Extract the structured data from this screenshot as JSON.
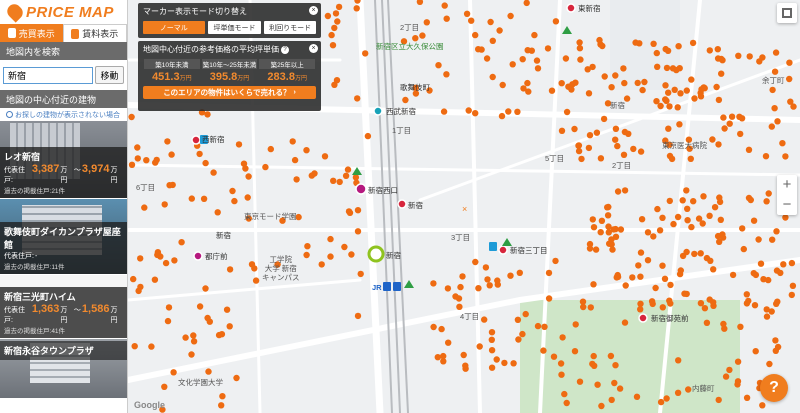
{
  "brand": {
    "name": "PRICE MAP",
    "color": "#f07d1e"
  },
  "tabs": [
    {
      "label": "売買表示",
      "icon": "sale-icon",
      "active": false
    },
    {
      "label": "賃料表示",
      "icon": "rent-icon",
      "active": true
    }
  ],
  "search": {
    "heading": "地図内を検索",
    "value": "新宿",
    "button": "移動"
  },
  "buildings_section": {
    "heading": "地図の中心付近の建物",
    "hint": "お探しの建物が表示されない場合"
  },
  "properties": [
    {
      "name": "レオ新宿",
      "price_label": "代表住戸:",
      "price_low": "3,387",
      "price_high": "3,974",
      "unit": "万円",
      "sep": "～",
      "count_label": "過去の掲載住戸:",
      "count": "21件"
    },
    {
      "name": "歌舞伎町ダイカンプラザ屋座館",
      "price_label": "代表住戸:",
      "price_low": "-",
      "price_high": "",
      "unit": "",
      "sep": "",
      "count_label": "過去の掲載住戸:",
      "count": "11件"
    },
    {
      "name": "新宿三光町ハイム",
      "price_label": "代表住戸:",
      "price_low": "1,363",
      "price_high": "1,586",
      "unit": "万円",
      "sep": "～",
      "count_label": "過去の掲載住戸:",
      "count": "41件"
    },
    {
      "name": "新宿永谷タウンプラザ",
      "price_label": "",
      "price_low": "",
      "price_high": "",
      "unit": "",
      "sep": "",
      "count_label": "",
      "count": ""
    }
  ],
  "mode_panel": {
    "title": "マーカー表示モード切り替え",
    "buttons": [
      "ノーマル",
      "坪単価モード",
      "利回りモード"
    ],
    "active": 0
  },
  "price_panel": {
    "title": "地図中心付近の参考価格の平均坪単価",
    "columns": [
      {
        "label": "築10年未満",
        "value": "451.3",
        "unit": "万円"
      },
      {
        "label": "築10年～25年未満",
        "value": "395.8",
        "unit": "万円"
      },
      {
        "label": "築25年以上",
        "value": "283.8",
        "unit": "万円"
      }
    ],
    "cta": "このエリアの物件はいくらで売れる？"
  },
  "map_labels": {
    "shinjuku_park": "新宿区立大久保公園",
    "kabukicho": "歌舞伎町",
    "nishi_shinjuku_ekimae": "西武新宿",
    "chome1": "1丁目",
    "chome2": "2丁目",
    "chome3": "3丁目",
    "chome4": "4丁目",
    "chome5": "5丁目",
    "chome6": "6丁目",
    "shinjuku_nishiguchi": "新宿西口",
    "shinjuku_station": "新宿",
    "shinjuku_station2": "新宿",
    "nishi_shinjuku": "西新宿",
    "tocho": "都庁前",
    "tokyo_mode": "東京モード学園",
    "kogakuin": "工学院\n大学 新宿\nキャンパス",
    "shinjuku_sanchome": "新宿三丁目",
    "shinjuku_gyoenmae": "新宿御苑前",
    "bunka_gakuen": "文化学園大学",
    "higashi_shinjuku": "東新宿",
    "tokyo_medical": "東京医大病院",
    "yotsuya": "余丁町",
    "naito": "内藤町",
    "shinjuku_bunka": "新宿",
    "jr": "JR"
  },
  "controls": {
    "zoom_in": "+",
    "zoom_out": "−",
    "help": "?"
  },
  "colors": {
    "marker": "#ee6b12",
    "station": "#d7263d",
    "accent": "#f07d1e"
  },
  "attribution": "Google"
}
